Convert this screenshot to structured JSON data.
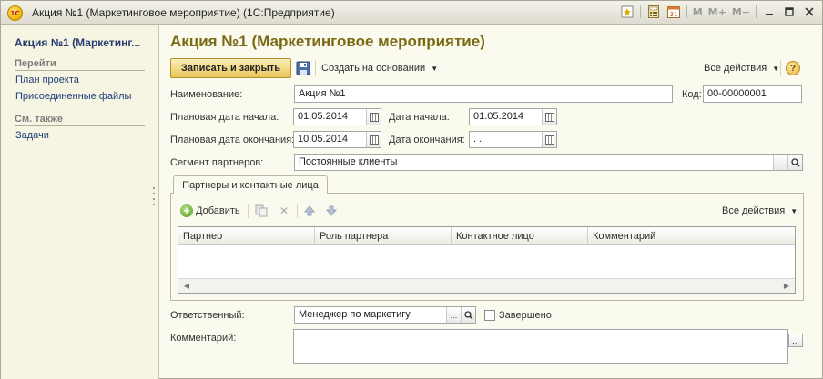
{
  "window": {
    "logo_text": "1С",
    "title": "Акция №1 (Маркетинговое мероприятие)  (1С:Предприятие)",
    "memory_buttons": [
      "M",
      "M+",
      "M−"
    ]
  },
  "sidebar": {
    "title": "Акция №1 (Маркетинг...",
    "sections": [
      {
        "heading": "Перейти",
        "items": [
          "План проекта",
          "Присоединенные файлы"
        ]
      },
      {
        "heading": "См. также",
        "items": [
          "Задачи"
        ]
      }
    ]
  },
  "form": {
    "title": "Акция №1 (Маркетинговое мероприятие)",
    "toolbar": {
      "save_close": "Записать и закрыть",
      "create_based_on": "Создать на основании",
      "all_actions": "Все действия",
      "help": "?"
    },
    "fields": {
      "name_label": "Наименование:",
      "name_value": "Акция №1",
      "code_label": "Код:",
      "code_value": "00-00000001",
      "planned_start_label": "Плановая дата начала:",
      "planned_start_value": "01.05.2014",
      "start_label": "Дата начала:",
      "start_value": "01.05.2014",
      "planned_end_label": "Плановая дата окончания:",
      "planned_end_value": "10.05.2014",
      "end_label": "Дата окончания:",
      "end_value": " .  .",
      "segment_label": "Сегмент партнеров:",
      "segment_value": "Постоянные клиенты",
      "responsible_label": "Ответственный:",
      "responsible_value": "Менеджер по маркетигу",
      "completed_label": "Завершено",
      "comment_label": "Комментарий:",
      "comment_value": ""
    },
    "partners_tab": {
      "tab_label": "Партнеры и контактные лица",
      "add_label": "Добавить",
      "all_actions": "Все действия",
      "columns": [
        "Партнер",
        "Роль партнера",
        "Контактное лицо",
        "Комментарий"
      ],
      "rows": []
    }
  }
}
